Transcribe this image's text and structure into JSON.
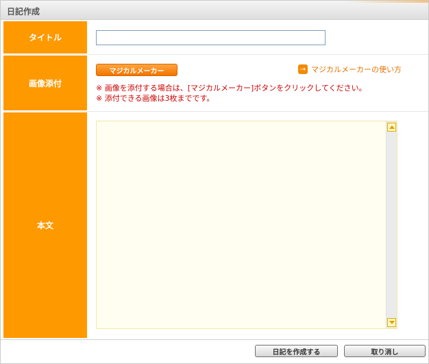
{
  "window": {
    "title": "日記作成"
  },
  "form": {
    "title_row": {
      "label": "タイトル",
      "input_value": "",
      "input_placeholder": ""
    },
    "image_row": {
      "label": "画像添付",
      "magical_button": "マジカルメーカー",
      "howto_link": "マジカルメーカーの使い方",
      "note1": "※ 画像を添付する場合は、[マジカルメーカー]ボタンをクリックしてください。",
      "note2": "※ 添付できる画像は3枚までです。"
    },
    "body_row": {
      "label": "本文",
      "textarea_value": ""
    }
  },
  "footer": {
    "create_label": "日記を作成する",
    "cancel_label": "取り消し"
  },
  "colors": {
    "label_bg": "#ff9900",
    "accent": "#f27400",
    "note": "#cc0000",
    "textarea_bg": "#fffef0"
  },
  "icons": {
    "howto": "arrow-right-icon",
    "scroll_up": "scroll-up-icon",
    "scroll_down": "scroll-down-icon"
  }
}
